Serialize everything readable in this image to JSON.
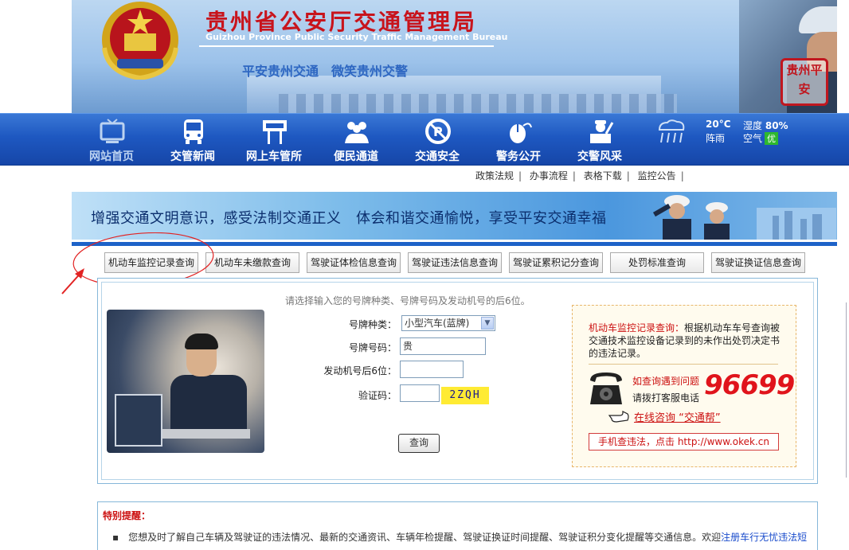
{
  "header": {
    "title_cn": "贵州省公安厅交通管理局",
    "title_en": "Guizhou Province Public Security Traffic Management Bureau",
    "slogan": "平安贵州交通　微笑贵州交警",
    "seal_text": "贵州平安"
  },
  "nav": {
    "items": [
      {
        "label": "网站首页",
        "icon": "tv-icon"
      },
      {
        "label": "交管新闻",
        "icon": "bus-icon"
      },
      {
        "label": "网上车管所",
        "icon": "signboard-icon"
      },
      {
        "label": "便民通道",
        "icon": "people-icon"
      },
      {
        "label": "交通安全",
        "icon": "no-parking-icon"
      },
      {
        "label": "警务公开",
        "icon": "mouse-icon"
      },
      {
        "label": "交警风采",
        "icon": "officer-icon"
      }
    ],
    "active_index": 0
  },
  "weather": {
    "temp": "20°C",
    "desc": "阵雨",
    "humidity_label": "湿度",
    "humidity_value": "80%",
    "air_label": "空气",
    "air_quality": "优",
    "icon": "rain-icon"
  },
  "sublinks": [
    "政策法规",
    "办事流程",
    "表格下载",
    "监控公告"
  ],
  "safety_banner": {
    "text": "增强交通文明意识，感受法制交通正义　体会和谐交通愉悦，享受平安交通幸福"
  },
  "tabs": [
    "机动车监控记录查询",
    "机动车未缴款查询",
    "驾驶证体检信息查询",
    "驾驶证违法信息查询",
    "驾驶证累积记分查询",
    "处罚标准查询",
    "驾驶证换证信息查询"
  ],
  "query_form": {
    "hint": "请选择输入您的号牌种类、号牌号码及发动机号的后6位。",
    "plate_type_label": "号牌种类：",
    "plate_type_value": "小型汽车(蓝牌)",
    "plate_number_label": "号牌号码：",
    "plate_number_value": "贵",
    "engine_label": "发动机号后6位：",
    "engine_value": "",
    "captcha_label": "验证码：",
    "captcha_value": "",
    "captcha_text": "2ZQH",
    "submit_label": "查询"
  },
  "info_box": {
    "lead": "机动车监控记录查询：",
    "desc": "根据机动车车号查询被交通技术监控设备记录到的未作出处罚决定书的违法记录。",
    "problem_text": "如查询遇到问题",
    "call_text": "请拨打客服电话",
    "hotline": "96699",
    "online_text": "在线咨询 “交通帮”",
    "mobile_text": "手机查违法，点击 http://www.okek.cn"
  },
  "notice": {
    "title": "特别提醒：",
    "body": "您想及时了解自己车辆及驾驶证的违法情况、最新的交通资讯、车辆年检提醒、驾驶证换证时间提醒、驾驶证积分变化提醒等交通信息。欢迎",
    "link": "注册车行无忧违法短"
  },
  "colors": {
    "nav_bg": "#1e58c1",
    "title_red": "#c8141c",
    "hotline_red": "#e0141b",
    "captcha_bg": "#ffeb33",
    "air_good": "#2eb82e"
  }
}
